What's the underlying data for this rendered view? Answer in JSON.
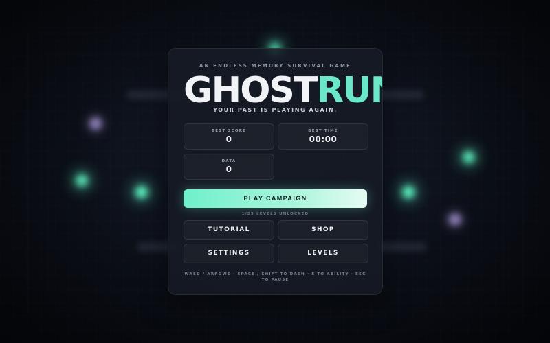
{
  "menu": {
    "tagline": "AN ENDLESS MEMORY SURVIVAL GAME",
    "logo": {
      "part1": "GHOST",
      "part2": "RUN"
    },
    "subtitle": "YOUR PAST IS PLAYING AGAIN.",
    "stats": [
      {
        "label": "BEST SCORE",
        "value": "0"
      },
      {
        "label": "BEST TIME",
        "value": "00:00"
      },
      {
        "label": "DATA",
        "value": "0"
      }
    ],
    "play_label": "PLAY CAMPAIGN",
    "levels_unlocked": "1/25 LEVELS UNLOCKED",
    "buttons": {
      "tutorial": "TUTORIAL",
      "shop": "SHOP",
      "settings": "SETTINGS",
      "levels": "LEVELS"
    },
    "controls_hint": "WASD / ARROWS · SPACE / SHIFT TO DASH · E TO ABILITY · ESC TO PAUSE"
  },
  "colors": {
    "accent": "#6ae8c8",
    "logo_white": "#f2f3f7",
    "panel_bg": "#161a24",
    "background": "#0a0d16"
  }
}
